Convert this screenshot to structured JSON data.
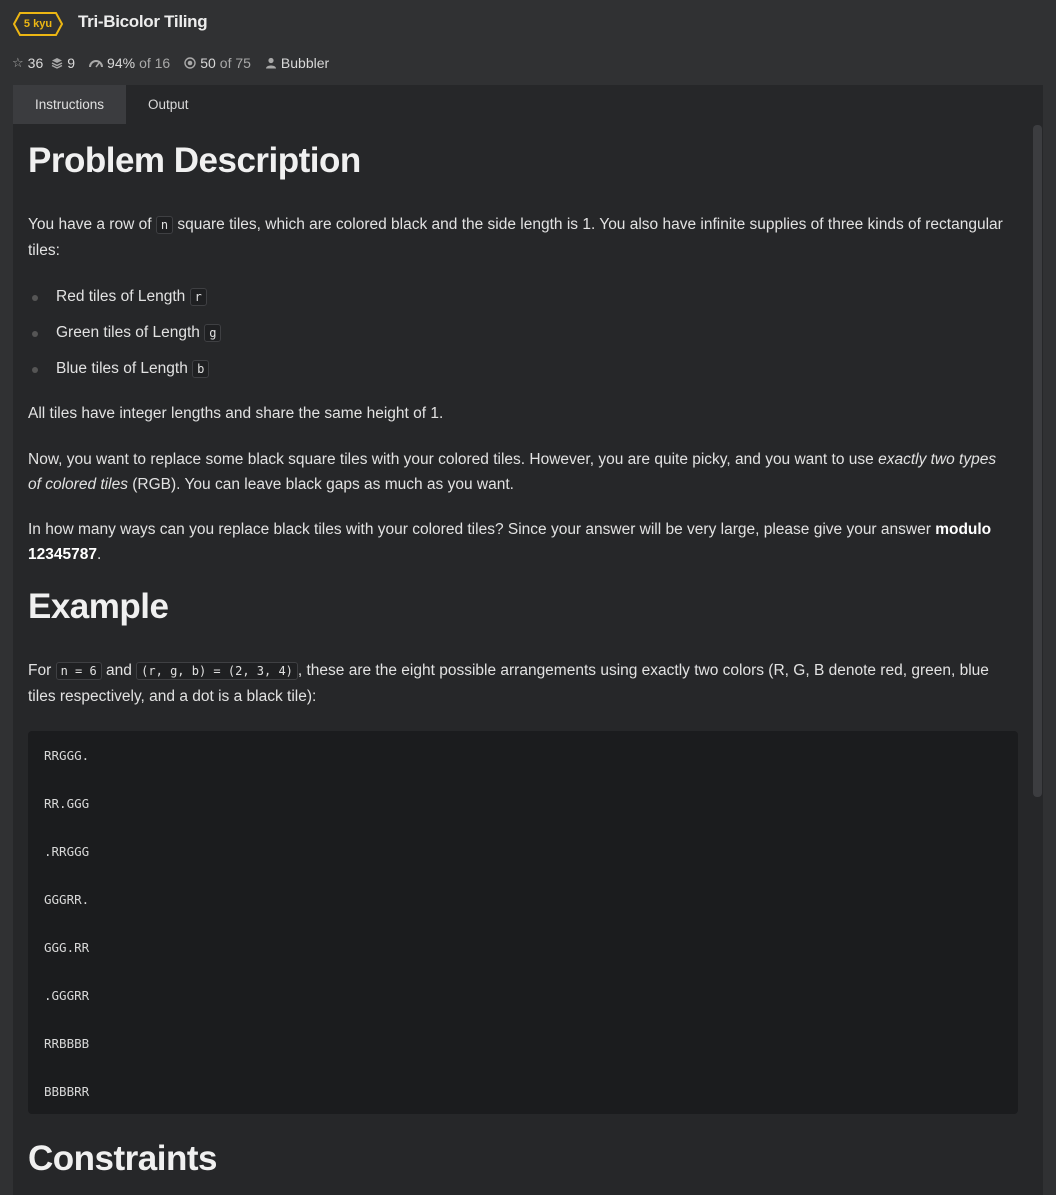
{
  "header": {
    "rank": "5 kyu",
    "title": "Tri-Bicolor Tiling",
    "stats": {
      "stars": "36",
      "collections": "9",
      "satisfaction": "94%",
      "satisfaction_suffix": "of 16",
      "completed": "50",
      "completed_suffix": "of 75",
      "author": "Bubbler"
    }
  },
  "tabs": [
    {
      "label": "Instructions",
      "active": true
    },
    {
      "label": "Output",
      "active": false
    }
  ],
  "content": {
    "h_problem": "Problem Description",
    "p1_a": "You have a row of ",
    "p1_code": "n",
    "p1_b": " square tiles, which are colored black and the side length is 1. You also have infinite supplies of three kinds of rectangular tiles:",
    "list": [
      {
        "text": "Red tiles of Length ",
        "code": "r"
      },
      {
        "text": "Green tiles of Length ",
        "code": "g"
      },
      {
        "text": "Blue tiles of Length ",
        "code": "b"
      }
    ],
    "p2": "All tiles have integer lengths and share the same height of 1.",
    "p3_a": "Now, you want to replace some black square tiles with your colored tiles. However, you are quite picky, and you want to use ",
    "p3_em": "exactly two types of colored tiles",
    "p3_b": " (RGB). You can leave black gaps as much as you want.",
    "p4_a": "In how many ways can you replace black tiles with your colored tiles? Since your answer will be very large, please give your answer ",
    "p4_strong": "modulo 12345787",
    "p4_b": ".",
    "h_example": "Example",
    "p5_a": "For ",
    "p5_code1": "n = 6",
    "p5_b": " and ",
    "p5_code2": "(r, g, b) = (2, 3, 4)",
    "p5_c": ", these are the eight possible arrangements using exactly two colors (R, G, B denote red, green, blue tiles respectively, and a dot is a black tile):",
    "code_lines": [
      "RRGGG.",
      "RR.GGG",
      ".RRGGG",
      "GGGRR.",
      "GGG.RR",
      ".GGGRR",
      "RRBBBB",
      "BBBBRR"
    ],
    "h_constraints": "Constraints"
  },
  "colors": {
    "rank": "#ecb613",
    "background": "#303133",
    "panel": "#262729",
    "code_bg": "#1b1c1e"
  }
}
